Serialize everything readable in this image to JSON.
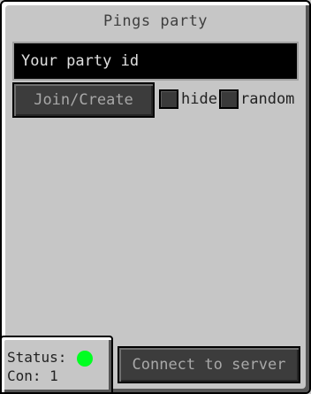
{
  "window": {
    "title": "Pings party"
  },
  "party": {
    "placeholder": "Your party id",
    "value": ""
  },
  "buttons": {
    "join_label": "Join/Create",
    "connect_label": "Connect to server"
  },
  "options": {
    "hide_label": "hide",
    "hide_checked": false,
    "random_label": "random",
    "random_checked": false
  },
  "status": {
    "status_label": "Status:",
    "status_color": "#00ff22",
    "con_label": "Con:",
    "con_count": "1"
  },
  "colors": {
    "panel_bg": "#c6c6c6",
    "button_bg": "#3c3c3c",
    "input_bg": "#000000",
    "status_online": "#00ff22"
  }
}
